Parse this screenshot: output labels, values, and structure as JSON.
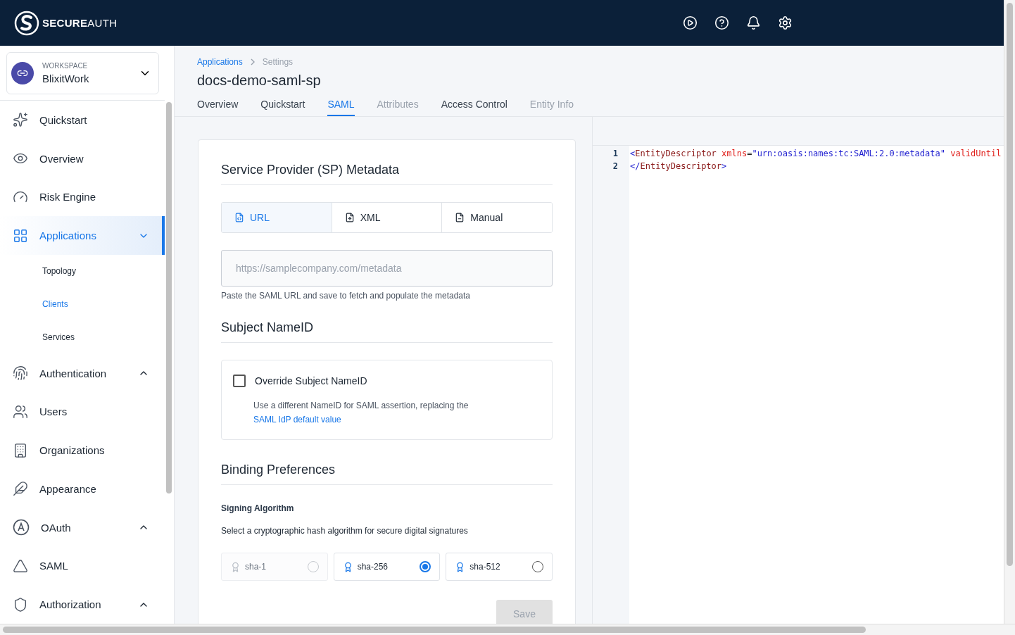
{
  "header": {
    "logo": "**SECURE**AUTH"
  },
  "workspace": {
    "label": "WORKSPACE",
    "name": "BlixitWork"
  },
  "sidebar": {
    "items": [
      {
        "label": "Quickstart",
        "selected": false
      },
      {
        "label": "Overview",
        "selected": false
      },
      {
        "label": "Risk Engine",
        "selected": false
      },
      {
        "label": "Applications",
        "selected": true,
        "expanded": true,
        "children": [
          {
            "label": "Topology",
            "selected": false
          },
          {
            "label": "Clients",
            "selected": true
          },
          {
            "label": "Services",
            "selected": false
          }
        ]
      },
      {
        "label": "Authentication",
        "selected": false,
        "expanded": false
      },
      {
        "label": "Users",
        "selected": false
      },
      {
        "label": "Organizations",
        "selected": false
      },
      {
        "label": "Appearance",
        "selected": false
      },
      {
        "label": "OAuth",
        "selected": false,
        "expanded": false
      },
      {
        "label": "SAML",
        "selected": false
      },
      {
        "label": "Authorization",
        "selected": false,
        "expanded": false
      }
    ]
  },
  "breadcrumb": [
    {
      "label": "Applications",
      "link": true
    },
    {
      "label": "Settings",
      "link": false
    }
  ],
  "title": "docs-demo-saml-sp",
  "tabs": [
    {
      "label": "Overview",
      "selected": false,
      "disabled": false
    },
    {
      "label": "Quickstart",
      "selected": false,
      "disabled": false
    },
    {
      "label": "SAML",
      "selected": true,
      "disabled": false
    },
    {
      "label": "Attributes",
      "selected": false,
      "disabled": true
    },
    {
      "label": "Access Control",
      "selected": false,
      "disabled": false
    },
    {
      "label": "Entity Info",
      "selected": false,
      "disabled": true
    }
  ],
  "metadata": {
    "heading": "Service Provider (SP) Metadata",
    "sources": [
      {
        "label": "URL",
        "selected": true
      },
      {
        "label": "XML",
        "selected": false
      },
      {
        "label": "Manual",
        "selected": false
      }
    ],
    "placeholder": "https://samplecompany.com/metadata",
    "hint": "Paste the SAML URL and save to fetch and populate the metadata"
  },
  "subject": {
    "heading": "Subject NameID",
    "checkbox": {
      "label": "Override Subject NameID",
      "checked": false
    },
    "description": "Use a different NameID for SAML assertion, replacing the",
    "link": "SAML IdP default value"
  },
  "binding": {
    "heading": "Binding Preferences",
    "subheading": "Signing Algorithm",
    "description": "Select a cryptographic hash algorithm for secure digital signatures",
    "options": [
      {
        "label": "sha-1",
        "selected": false,
        "disabled": true
      },
      {
        "label": "sha-256",
        "selected": true,
        "disabled": false
      },
      {
        "label": "sha-512",
        "selected": false,
        "disabled": false
      }
    ]
  },
  "save": {
    "label": "Save",
    "disabled": true
  },
  "code": {
    "lines": [
      {
        "number": "1",
        "tokens": [
          {
            "kind": "punct",
            "text": "<"
          },
          {
            "kind": "tag",
            "text": "EntityDescriptor"
          },
          {
            "kind": "attr",
            "text": " xmlns"
          },
          {
            "kind": "plain",
            "text": "="
          },
          {
            "kind": "value",
            "text": "\"urn:oasis:names:tc:SAML:2.0:metadata\""
          },
          {
            "kind": "attr",
            "text": " validUntil"
          }
        ]
      },
      {
        "number": "2",
        "tokens": [
          {
            "kind": "punct",
            "text": "</"
          },
          {
            "kind": "tag",
            "text": "EntityDescriptor"
          },
          {
            "kind": "punct",
            "text": ">"
          }
        ]
      }
    ]
  }
}
